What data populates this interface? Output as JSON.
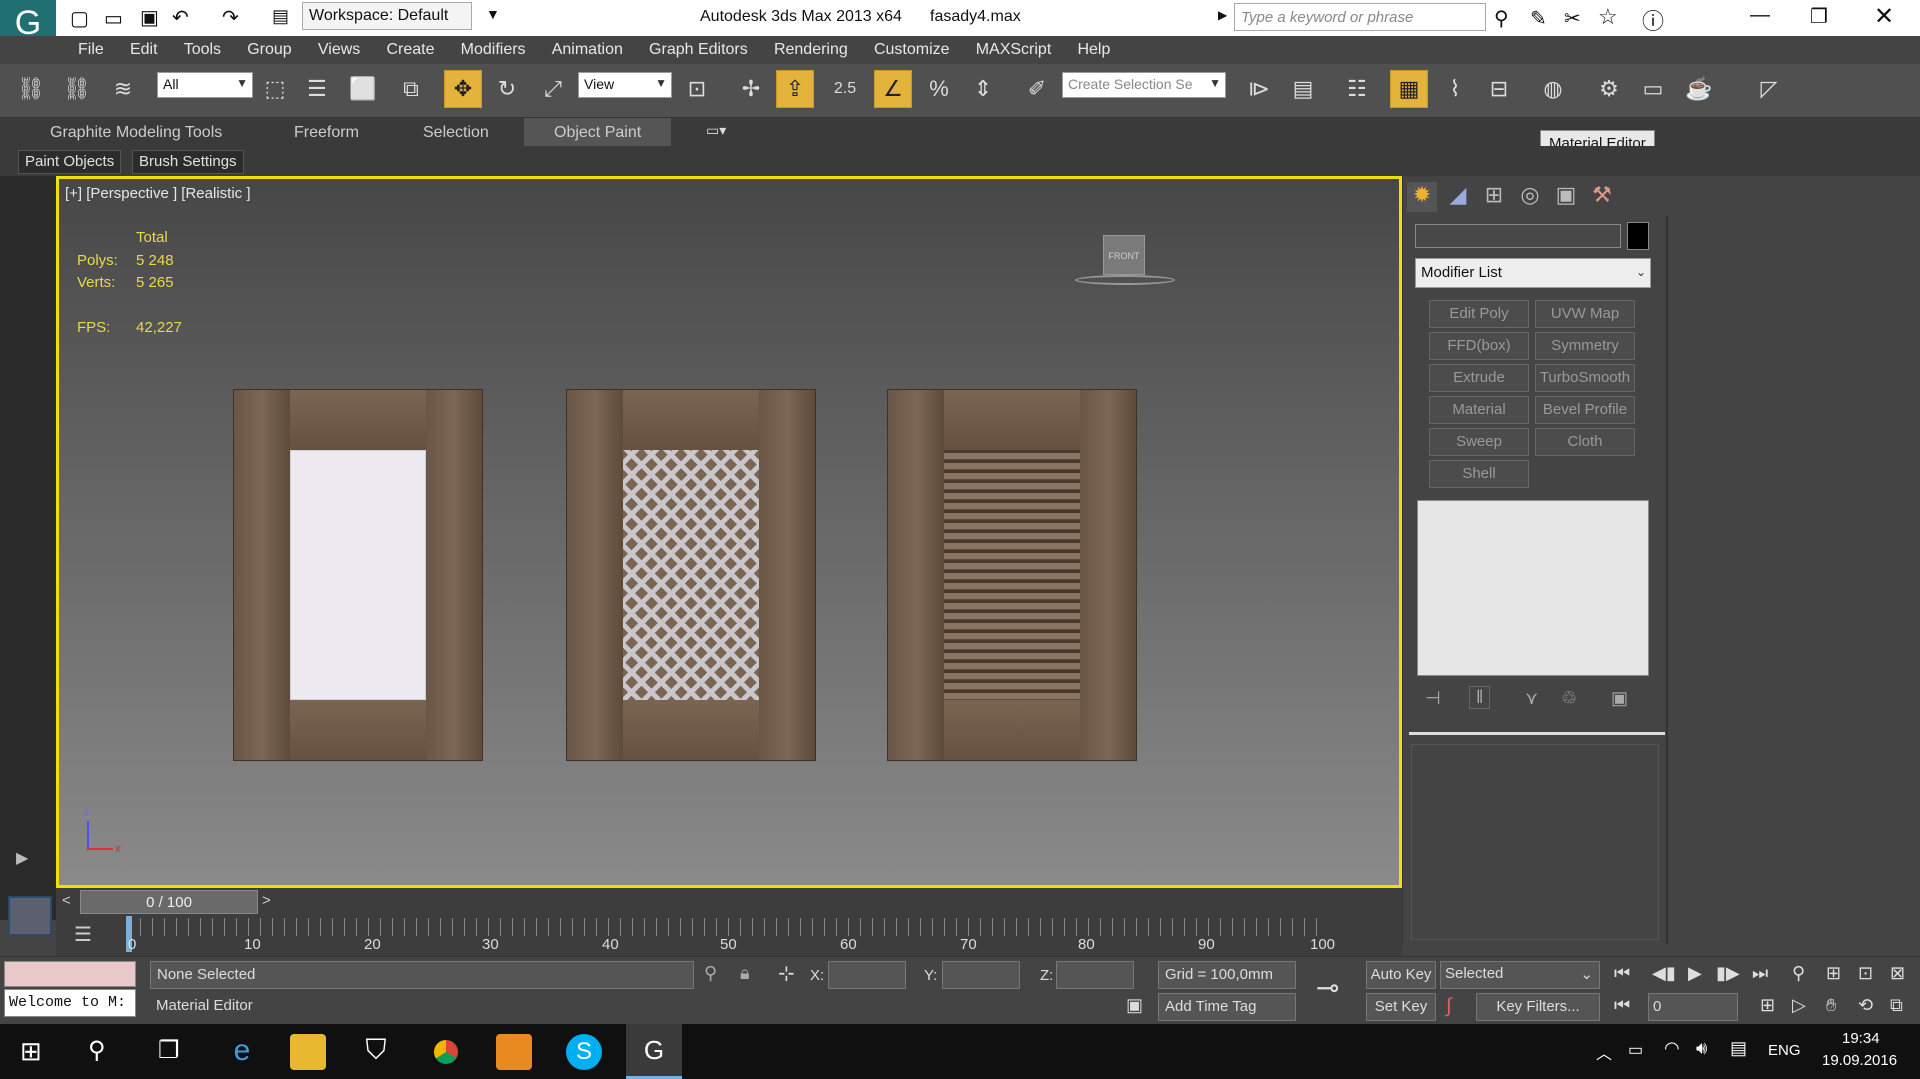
{
  "title": {
    "workspace": "Workspace: Default",
    "app": "Autodesk 3ds Max  2013 x64",
    "file": "fasady4.max",
    "search_placeholder": "Type a keyword or phrase"
  },
  "menu": [
    "File",
    "Edit",
    "Tools",
    "Group",
    "Views",
    "Create",
    "Modifiers",
    "Animation",
    "Graph Editors",
    "Rendering",
    "Customize",
    "MAXScript",
    "Help"
  ],
  "toolbar": {
    "filter": "All",
    "refcoord": "View",
    "snap_value": "2.5",
    "selection_set": "Create Selection Se"
  },
  "tooltip": "Material Editor",
  "ribbon": {
    "tabs": [
      "Graphite Modeling Tools",
      "Freeform",
      "Selection",
      "Object Paint"
    ],
    "sub": [
      "Paint Objects",
      "Brush Settings"
    ]
  },
  "viewport": {
    "label": "[+] [Perspective ] [Realistic ]",
    "total": "Total",
    "polys_label": "Polys:",
    "polys": "5 248",
    "verts_label": "Verts:",
    "verts": "5 265",
    "fps_label": "FPS:",
    "fps": "42,227",
    "cube": "FRONT",
    "axis_z": "z",
    "axis_x": "x"
  },
  "command_panel": {
    "modifier_list": "Modifier List",
    "buttons": [
      "Edit Poly",
      "UVW Map",
      "FFD(box)",
      "Symmetry",
      "Extrude",
      "TurboSmooth",
      "Material",
      "Bevel Profile",
      "Sweep",
      "Cloth",
      "Shell"
    ]
  },
  "timeline": {
    "frame": "0 / 100",
    "ticks": [
      "0",
      "10",
      "20",
      "30",
      "40",
      "50",
      "60",
      "70",
      "80",
      "90",
      "100"
    ]
  },
  "status": {
    "maxscript": "Welcome to M:",
    "selection": "None Selected",
    "prompt": "Material Editor",
    "x": "X:",
    "y": "Y:",
    "z": "Z:",
    "grid": "Grid = 100,0mm",
    "add_time_tag": "Add Time Tag",
    "auto_key": "Auto Key",
    "set_key": "Set Key",
    "key_filter": "Selected",
    "key_filters": "Key Filters...",
    "frame_input": "0"
  },
  "taskbar": {
    "lang": "ENG",
    "time": "19:34",
    "date": "19.09.2016"
  }
}
